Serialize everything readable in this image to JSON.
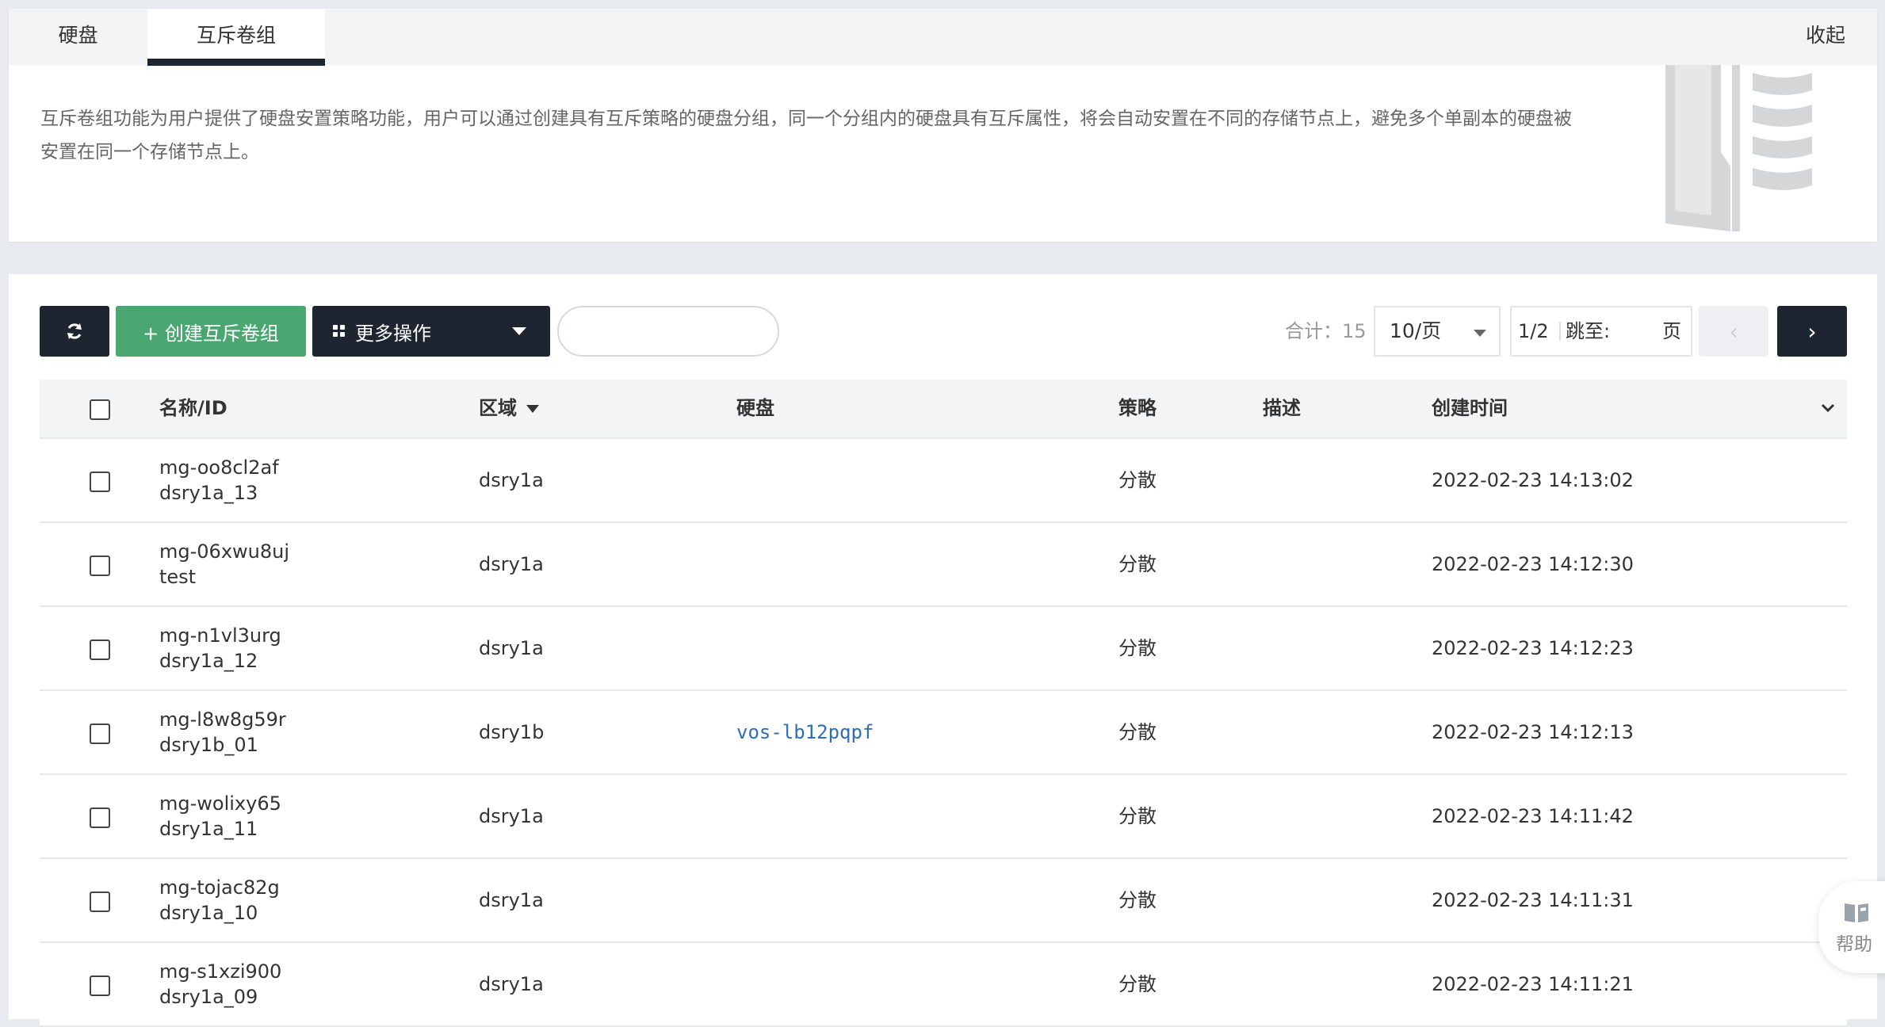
{
  "tabs": [
    {
      "label": "硬盘"
    },
    {
      "label": "互斥卷组"
    }
  ],
  "collapse_label": "收起",
  "intro_text": "互斥卷组功能为用户提供了硬盘安置策略功能，用户可以通过创建具有互斥策略的硬盘分组，同一个分组内的硬盘具有互斥属性，将会自动安置在不同的存储节点上，避免多个单副本的硬盘被安置在同一个存储节点上。",
  "toolbar": {
    "create_label": "+ 创建互斥卷组",
    "more_label": "更多操作",
    "search_placeholder": ""
  },
  "pagination": {
    "total_label": "合计：15",
    "page_size": "10/页",
    "current": "1/2",
    "jump_label": "跳至:",
    "page_unit": "页"
  },
  "table": {
    "columns": {
      "name": "名称/ID",
      "region": "区域",
      "disk": "硬盘",
      "policy": "策略",
      "description": "描述",
      "created": "创建时间"
    },
    "rows": [
      {
        "id": "mg-oo8cl2af",
        "name": "dsry1a_13",
        "region": "dsry1a",
        "disk": "",
        "policy": "分散",
        "description": "",
        "created": "2022-02-23 14:13:02"
      },
      {
        "id": "mg-06xwu8uj",
        "name": "test",
        "region": "dsry1a",
        "disk": "",
        "policy": "分散",
        "description": "",
        "created": "2022-02-23 14:12:30"
      },
      {
        "id": "mg-n1vl3urg",
        "name": "dsry1a_12",
        "region": "dsry1a",
        "disk": "",
        "policy": "分散",
        "description": "",
        "created": "2022-02-23 14:12:23"
      },
      {
        "id": "mg-l8w8g59r",
        "name": "dsry1b_01",
        "region": "dsry1b",
        "disk": "vos-lb12pqpf",
        "policy": "分散",
        "description": "",
        "created": "2022-02-23 14:12:13"
      },
      {
        "id": "mg-wolixy65",
        "name": "dsry1a_11",
        "region": "dsry1a",
        "disk": "",
        "policy": "分散",
        "description": "",
        "created": "2022-02-23 14:11:42"
      },
      {
        "id": "mg-tojac82g",
        "name": "dsry1a_10",
        "region": "dsry1a",
        "disk": "",
        "policy": "分散",
        "description": "",
        "created": "2022-02-23 14:11:31"
      },
      {
        "id": "mg-s1xzi900",
        "name": "dsry1a_09",
        "region": "dsry1a",
        "disk": "",
        "policy": "分散",
        "description": "",
        "created": "2022-02-23 14:11:21"
      }
    ]
  },
  "help_label": "帮助",
  "colors": {
    "dark": "#1c2530",
    "green": "#4aa772",
    "link": "#2f6db5",
    "background": "#e8ecf1"
  }
}
